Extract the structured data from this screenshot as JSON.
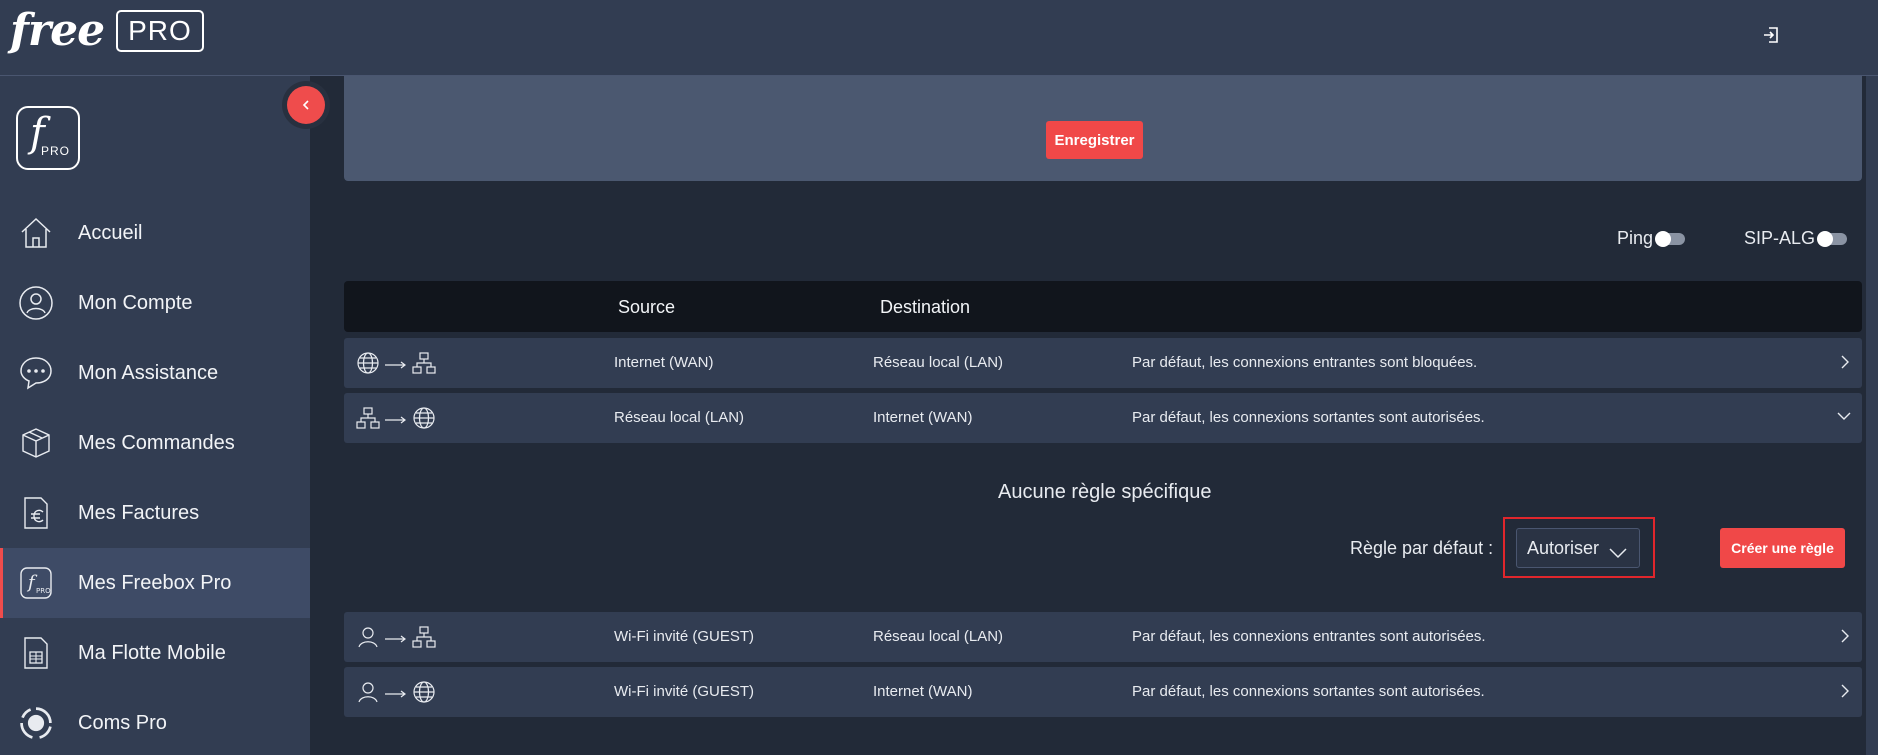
{
  "header": {
    "logo_text": "free",
    "logo_badge": "PRO",
    "logout_icon": "logout-icon"
  },
  "sidebar": {
    "logo_letter": "f",
    "logo_sub": "PRO",
    "collapse_icon": "chevron-left-icon",
    "items": [
      {
        "label": "Accueil",
        "icon": "home-icon"
      },
      {
        "label": "Mon Compte",
        "icon": "user-circle-icon"
      },
      {
        "label": "Mon Assistance",
        "icon": "chat-bubble-icon"
      },
      {
        "label": "Mes Commandes",
        "icon": "package-icon"
      },
      {
        "label": "Mes Factures",
        "icon": "invoice-euro-icon"
      },
      {
        "label": "Mes Freebox Pro",
        "icon": "freebox-pro-icon",
        "active": true
      },
      {
        "label": "Ma Flotte Mobile",
        "icon": "sim-card-icon"
      },
      {
        "label": "Coms Pro",
        "icon": "coms-pro-icon"
      }
    ]
  },
  "main": {
    "save_button": "Enregistrer",
    "toggles": {
      "ping": {
        "label": "Ping",
        "on": false
      },
      "sip_alg": {
        "label": "SIP-ALG",
        "on": false
      }
    },
    "table": {
      "headers": {
        "source": "Source",
        "destination": "Destination"
      },
      "rows": [
        {
          "source": "Internet (WAN)",
          "destination": "Réseau local (LAN)",
          "description": "Par défaut, les connexions entrantes sont bloquées.",
          "from_icon": "globe-icon",
          "to_icon": "network-icon",
          "expanded": false
        },
        {
          "source": "Réseau local (LAN)",
          "destination": "Internet (WAN)",
          "description": "Par défaut, les connexions sortantes sont autorisées.",
          "from_icon": "network-icon",
          "to_icon": "globe-icon",
          "expanded": true
        },
        {
          "source": "Wi-Fi invité (GUEST)",
          "destination": "Réseau local (LAN)",
          "description": "Par défaut, les connexions entrantes sont autorisées.",
          "from_icon": "user-icon",
          "to_icon": "network-icon",
          "expanded": false
        },
        {
          "source": "Wi-Fi invité (GUEST)",
          "destination": "Internet (WAN)",
          "description": "Par défaut, les connexions sortantes sont autorisées.",
          "from_icon": "user-icon",
          "to_icon": "globe-icon",
          "expanded": false
        }
      ]
    },
    "expanded_panel": {
      "empty_text": "Aucune règle spécifique",
      "default_rule_label": "Règle par défaut :",
      "default_rule_value": "Autoriser",
      "create_button": "Créer une règle"
    }
  },
  "colors": {
    "accent_red": "#f04848",
    "sidebar_bg": "#323d52",
    "main_bg": "#222a38",
    "header_row_bg": "#11151c",
    "highlight_border": "#e0262c"
  }
}
